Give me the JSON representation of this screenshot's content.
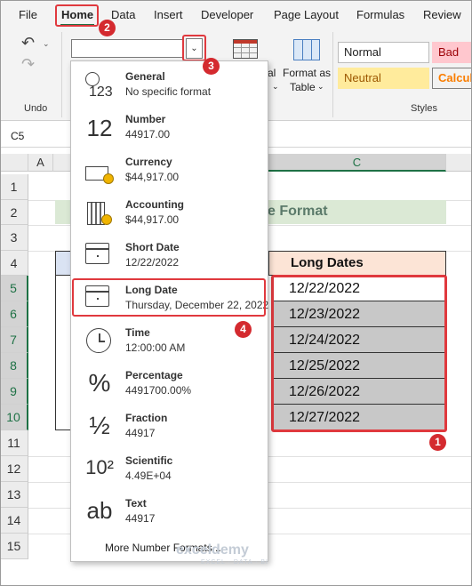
{
  "tabs": [
    "File",
    "Home",
    "Data",
    "Insert",
    "Developer",
    "Page Layout",
    "Formulas",
    "Review"
  ],
  "ribbon": {
    "undo_group": "Undo",
    "format_as_table": "Format as",
    "format_as_table_2": "Table",
    "conditional_partial": "al",
    "styles_group": "Styles",
    "styles": [
      {
        "label": "Normal",
        "bg": "#ffffff",
        "color": "#222222"
      },
      {
        "label": "Bad",
        "bg": "#ffc7ce",
        "color": "#9c0006"
      },
      {
        "label": "Neutral",
        "bg": "#ffeb9c",
        "color": "#9c5700"
      },
      {
        "label": "Calcul",
        "bg": "#f2f2f2",
        "color": "#fa7d00"
      }
    ]
  },
  "name_box": "C5",
  "columns": [
    "A",
    "C"
  ],
  "rows": [
    "1",
    "2",
    "3",
    "4",
    "5",
    "6",
    "7",
    "8",
    "9",
    "10",
    "11",
    "12",
    "13",
    "14",
    "15"
  ],
  "sheet": {
    "title_partial": "e Format",
    "header": "Long Dates",
    "dates": [
      "12/22/2022",
      "12/23/2022",
      "12/24/2022",
      "12/25/2022",
      "12/26/2022",
      "12/27/2022"
    ]
  },
  "dropdown": {
    "items": [
      {
        "name": "General",
        "sub": "No specific format",
        "icon": "clock-123-icon",
        "glyph": "123"
      },
      {
        "name": "Number",
        "sub": "44917.00",
        "icon": "number-12-icon",
        "glyph": "12"
      },
      {
        "name": "Currency",
        "sub": "$44,917.00",
        "icon": "currency-icon",
        "glyph": "💵"
      },
      {
        "name": "Accounting",
        "sub": "$44,917.00",
        "icon": "calculator-icon",
        "glyph": "🖩"
      },
      {
        "name": "Short Date",
        "sub": "12/22/2022",
        "icon": "calendar-icon",
        "glyph": ""
      },
      {
        "name": "Long Date",
        "sub": "Thursday, December 22, 2022",
        "icon": "calendar-icon",
        "glyph": ""
      },
      {
        "name": "Time",
        "sub": "12:00:00 AM",
        "icon": "clock-icon",
        "glyph": "🕓"
      },
      {
        "name": "Percentage",
        "sub": "4491700.00%",
        "icon": "percent-icon",
        "glyph": "%"
      },
      {
        "name": "Fraction",
        "sub": "44917",
        "icon": "fraction-icon",
        "glyph": "½"
      },
      {
        "name": "Scientific",
        "sub": "4.49E+04",
        "icon": "scientific-icon",
        "glyph": "10²"
      },
      {
        "name": "Text",
        "sub": "44917",
        "icon": "text-ab-icon",
        "glyph": "ab"
      }
    ],
    "more": "More Number Formats..."
  },
  "badges": [
    "1",
    "2",
    "3",
    "4"
  ],
  "watermark": {
    "brand": "exceldemy",
    "tagline": "EXCEL · DATA · BI"
  }
}
